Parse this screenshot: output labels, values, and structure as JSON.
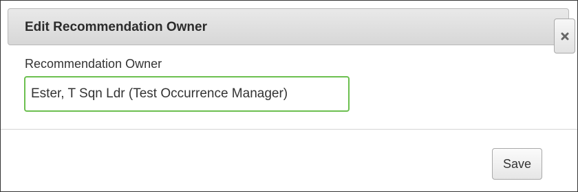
{
  "dialog": {
    "title": "Edit Recommendation Owner",
    "close_icon": "close-icon",
    "field_label": "Recommendation Owner",
    "owner_value": "Ester, T Sqn Ldr (Test Occurrence Manager)",
    "save_label": "Save"
  },
  "colors": {
    "input_focus_border": "#6bbf4e",
    "titlebar_background": "#dddddd"
  }
}
